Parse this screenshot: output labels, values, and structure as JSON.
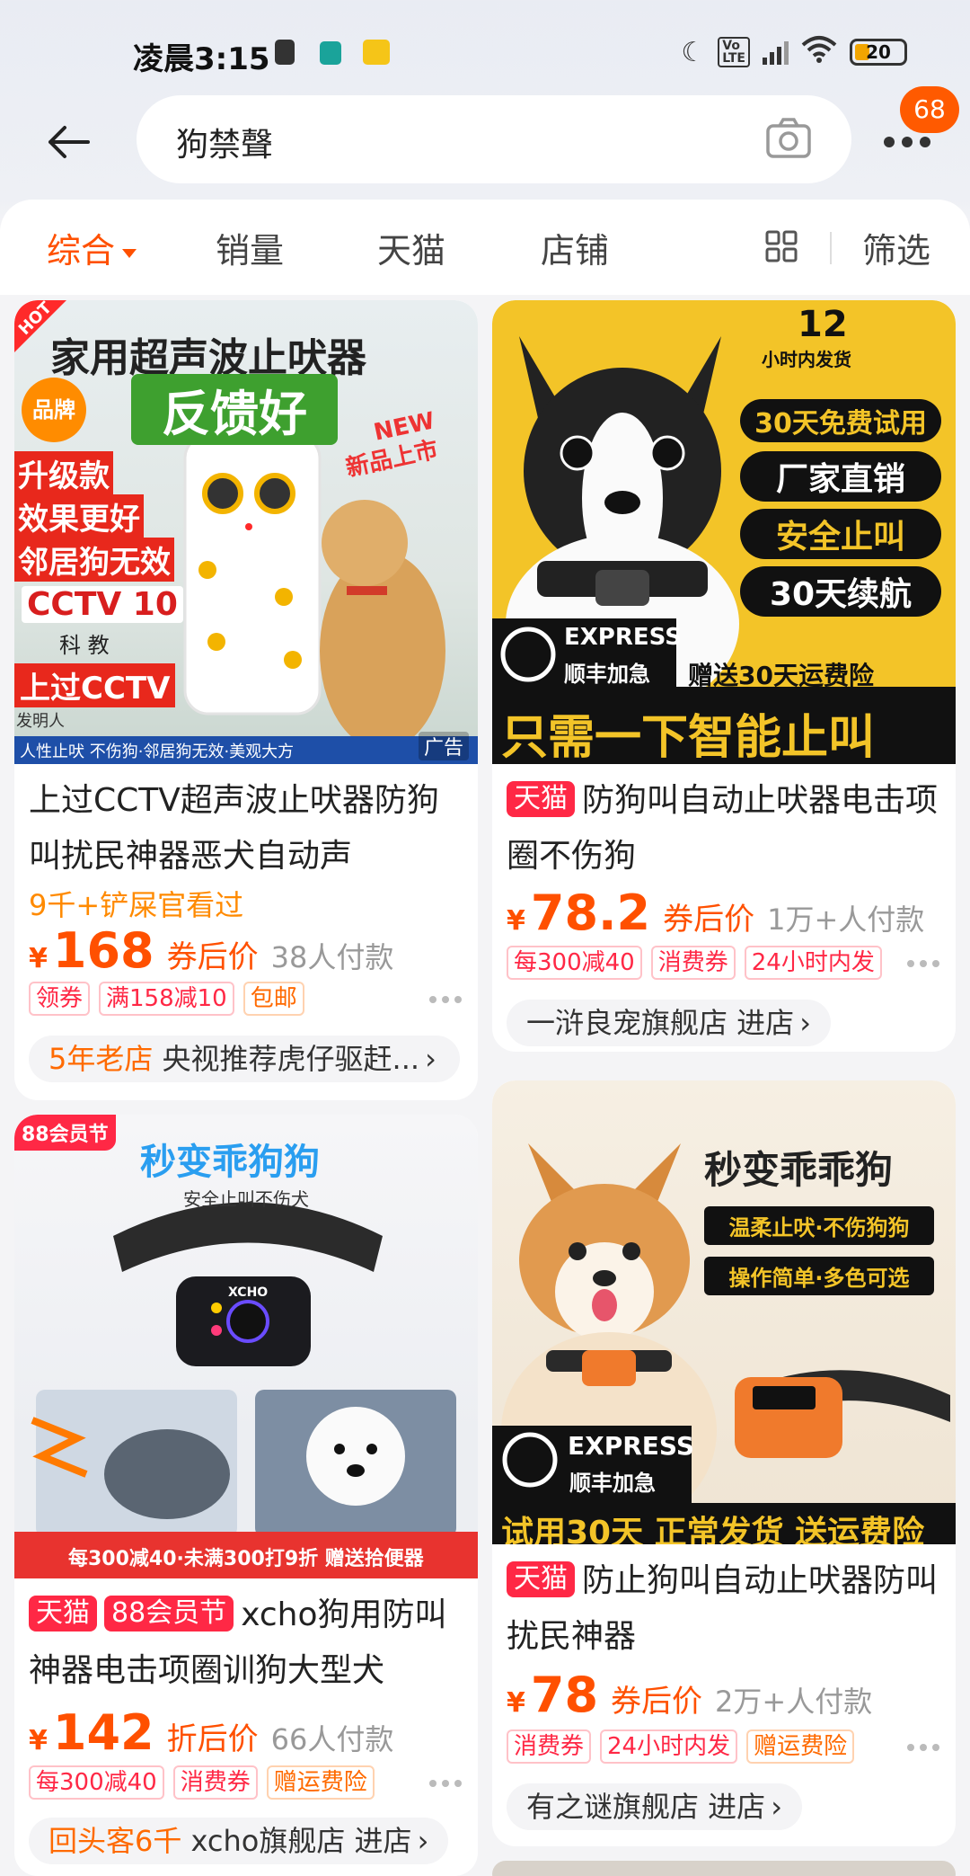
{
  "status": {
    "time": "凌晨3:15",
    "battery": "20"
  },
  "search": {
    "query": "狗禁聲",
    "badge_count": "68"
  },
  "sort_bar": {
    "items": [
      "综合",
      "销量",
      "天猫",
      "店铺"
    ],
    "filter": "筛选"
  },
  "products": [
    {
      "image_lines": [
        "家用超声波止吠器",
        "反馈好",
        "品牌",
        "NEW",
        "新品上市",
        "升级款",
        "效果更好",
        "邻居狗无效",
        "CCTV 10",
        "科 教",
        "上过CCTV",
        "发明人",
        "人性止吠 不伤狗·邻居狗无效·美观大方",
        "HOT"
      ],
      "ad_label": "广告",
      "title": "上过CCTV超声波止吠器防狗叫扰民神器恶犬自动声",
      "subline": "9千+铲屎官看过",
      "yen": "¥",
      "price": "168",
      "price_label": "券后价",
      "sold": "38人付款",
      "tags": [
        "领券",
        "满158减10",
        "包邮"
      ],
      "shop_highlight": "5年老店",
      "shop": "央视推荐虎仔驱赶..."
    },
    {
      "image_lines": [
        "12",
        "小时内发货",
        "30天免费试用",
        "厂家直销",
        "安全止叫",
        "30天续航",
        "EXPRESS",
        "顺丰加急",
        "赠送30天运费险",
        "只需一下智能止叫"
      ],
      "store_tag": "天猫",
      "title": "防狗叫自动止吠器电击项圈不伤狗",
      "yen": "¥",
      "price": "78.2",
      "price_label": "券后价",
      "sold": "1万+人付款",
      "tags": [
        "每300减40",
        "消费券",
        "24小时内发"
      ],
      "shop": "一浒良宠旗舰店 进店"
    },
    {
      "image_lines": [
        "88会员节",
        "秒变乖狗狗",
        "安全止叫不伤犬",
        "XCHO",
        "每300减40·未满300打9折 赠送拾便器"
      ],
      "store_tag": "天猫",
      "event_tag": "88会员节",
      "title": "xcho狗用防叫神器电击项圈训狗大型犬",
      "yen": "¥",
      "price": "142",
      "price_label": "折后价",
      "sold": "66人付款",
      "tags": [
        "每300减40",
        "消费券",
        "赠运费险"
      ],
      "shop_highlight": "回头客6千",
      "shop": "xcho旗舰店 进店"
    },
    {
      "image_lines": [
        "秒变乖乖狗",
        "温柔止吠·不伤狗狗",
        "操作简单·多色可选",
        "EXPRESS",
        "顺丰加急",
        "试用30天 正常发货 送运费险"
      ],
      "store_tag": "天猫",
      "title": "防止狗叫自动止吠器防叫扰民神器",
      "yen": "¥",
      "price": "78",
      "price_label": "券后价",
      "sold": "2万+人付款",
      "tags": [
        "消费券",
        "24小时内发",
        "赠运费险"
      ],
      "shop": "有之谜旗舰店 进店"
    }
  ],
  "colors": {
    "accent": "#ff5000",
    "tmall_red": "#ff2845",
    "sub_orange": "#ff8a00"
  }
}
